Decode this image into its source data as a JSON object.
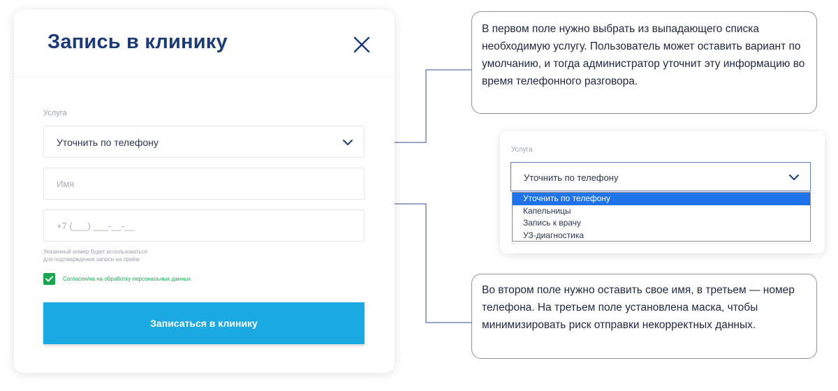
{
  "modal": {
    "title": "Запись в клинику",
    "service_label": "Услуга",
    "service_value": "Уточнить по телефону",
    "name_placeholder": "Имя",
    "phone_placeholder": "+7 (___) ___-__-__",
    "phone_hint_line1": "Указанный номер будет использоваться",
    "phone_hint_line2": "для подтверждения записи на приём",
    "consent_label": "Согласен/на на обработку персональных данных",
    "submit_label": "Записаться в клинику"
  },
  "callouts": {
    "top_text": "В первом поле нужно выбрать из выпадающего списка необходимую услугу. Пользователь может оставить вариант по умолчанию, и тогда администратор уточнит эту информацию во время телефонного разговора.",
    "bottom_text": "Во втором поле нужно оставить свое имя, в третьем — номер телефона. На третьем поле установлена маска, чтобы минимизировать риск отправки некорректных данных."
  },
  "dropdown_preview": {
    "label": "Услуга",
    "selected_value": "Уточнить по телефону",
    "options": [
      "Уточнить по телефону",
      "Капельницы",
      "Запись к врачу",
      "УЗ-диагностика"
    ]
  },
  "colors": {
    "title_blue": "#1b3a7a",
    "submit_bg": "#1aa9e1",
    "consent_green": "#1aa64f",
    "selected_option": "#1e73e8"
  },
  "icons": {
    "close": "close-icon",
    "chevron": "chevron-down-icon",
    "check": "check-icon"
  }
}
